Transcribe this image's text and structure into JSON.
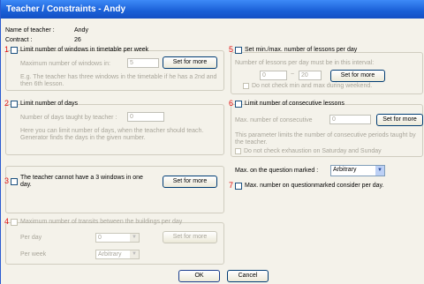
{
  "window": {
    "title": "Teacher / Constraints - Andy"
  },
  "teacher": {
    "name_label": "Name of teacher :",
    "name_value": "Andy",
    "contract_label": "Contract :",
    "contract_value": "26"
  },
  "numbers": {
    "n1": "1",
    "n2": "2",
    "n3": "3",
    "n4": "4",
    "n5": "5",
    "n6": "6",
    "n7": "7"
  },
  "c1": {
    "label": "Limit number of windows in timetable per week",
    "max_label": "Maximum number of windows in:",
    "max_value": "5",
    "button": "Set for more",
    "hint": "E.g. The teacher has three windows in the timetable if he has a 2nd and then 6th lesson."
  },
  "c2": {
    "label": "Limit number of days",
    "days_label": "Number of days taught by teacher :",
    "days_value": "0",
    "hint": "Here you can limit number of days, when the teacher should teach. Generator finds the days in the given number."
  },
  "c3": {
    "label": "The teacher cannot have a 3 windows in one day.",
    "button": "Set for more"
  },
  "c4": {
    "label": "Maximum number of transits between the buildings per day",
    "per_day_label": "Per day",
    "per_day_value": "0",
    "per_week_label": "Per week",
    "per_week_value": "Arbitrary",
    "button": "Set for more"
  },
  "c5": {
    "label": "Set min./max. number of lessons per day",
    "interval_label": "Number of lessons per day must be in this interval:",
    "min_value": "0",
    "separator": "~",
    "max_value": "20",
    "button": "Set for more",
    "weekend_label": "Do not check min and max during weekend."
  },
  "c6": {
    "label": "Limit number of consecutive lessons",
    "max_label": "Max. number of consecutive",
    "max_value": "0",
    "button": "Set for more",
    "hint": "This parameter limits the number of consecutive periods taught by the teacher.",
    "exhaustion_label": "Do not check exhaustion on Saturday and Sunday"
  },
  "question": {
    "label": "Max. on the question marked :",
    "value": "Arbitrary",
    "consider_label": "Max. number on questionmarked consider per day."
  },
  "footer": {
    "ok": "OK",
    "cancel": "Cancel"
  },
  "colors": {
    "title": "#1a5fd6",
    "accent_number": "#e01010",
    "disabled_text": "#a8a59a"
  }
}
